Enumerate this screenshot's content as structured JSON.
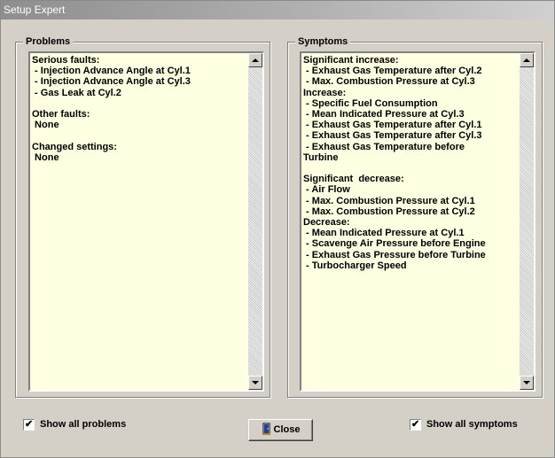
{
  "window": {
    "title": "Setup Expert"
  },
  "problems": {
    "group_label": "Problems",
    "lines": [
      "Serious faults:",
      " - Injection Advance Angle at Cyl.1",
      " - Injection Advance Angle at Cyl.3",
      " - Gas Leak at Cyl.2",
      "",
      "Other faults:",
      " None",
      "",
      "Changed settings:",
      " None"
    ]
  },
  "symptoms": {
    "group_label": "Symptoms",
    "lines": [
      "Significant increase:",
      " - Exhaust Gas Temperature after Cyl.2",
      " - Max. Combustion Pressure at Cyl.3",
      "Increase:",
      " - Specific Fuel Consumption",
      " - Mean Indicated Pressure at Cyl.3",
      " - Exhaust Gas Temperature after Cyl.1",
      " - Exhaust Gas Temperature after Cyl.3",
      " - Exhaust Gas Temperature before",
      "Turbine",
      "",
      "Significant  decrease:",
      " - Air Flow",
      " - Max. Combustion Pressure at Cyl.1",
      " - Max. Combustion Pressure at Cyl.2",
      "Decrease:",
      " - Mean Indicated Pressure at Cyl.1",
      " - Scavenge Air Pressure before Engine",
      " - Exhaust Gas Pressure before Turbine",
      " - Turbocharger Speed"
    ]
  },
  "footer": {
    "show_all_problems": {
      "label": "Show all problems",
      "checked": true
    },
    "close_button": {
      "label": "Close",
      "icon": "door-exit-icon"
    },
    "show_all_symptoms": {
      "label": "Show all symptoms",
      "checked": true
    }
  },
  "colors": {
    "list_background": "#ffffe1",
    "dialog_background": "#d4d0c8",
    "title_gradient_start": "#8e8e8e"
  }
}
